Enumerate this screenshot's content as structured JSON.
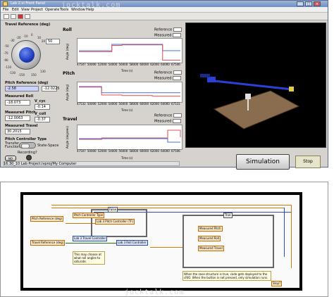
{
  "window": {
    "title": "Lab 2.vi Front Panel",
    "menu": [
      "File",
      "Edit",
      "View",
      "Project",
      "Operate",
      "Tools",
      "Window",
      "Help"
    ]
  },
  "watermark": "jocktalk.com",
  "controls": {
    "travel_reference": {
      "label": "Travel Reference (deg)",
      "value": "50",
      "scale": [
        "-10",
        "0",
        "10",
        "-20",
        "20",
        "-30",
        "30",
        "-40",
        "40",
        "-50",
        "50",
        "-60",
        "60",
        "-70",
        "70",
        "-80",
        "80",
        "-90",
        "90",
        "-100",
        "100",
        "-110",
        "110",
        "-120",
        "120",
        "-130",
        "130",
        "-140",
        "140",
        "-150",
        "150"
      ]
    },
    "pitch_reference": {
      "label": "Pitch Reference (deg)",
      "value": "-2.58",
      "value2": "-12.0225"
    },
    "measured_roll": {
      "label": "Measured Roll",
      "value": "-18.073"
    },
    "v_cyc": {
      "label": "V_cyc",
      "value": "-0.14"
    },
    "measured_pitch": {
      "label": "Measured Pitch",
      "value": "-12.0063"
    },
    "v_coll": {
      "label": "V_coll",
      "value": "-0.37"
    },
    "measured_travel": {
      "label": "Measured Travel",
      "value": "30.2015"
    },
    "pitch_controller_type": {
      "label": "Pitch Controller Type",
      "left": "Transfer Function",
      "right": "State-Space"
    },
    "recording": {
      "label": "Recording?"
    },
    "noimg": "NO"
  },
  "status": {
    "path": "16.30_10 Lab Project.lvproj/My Computer"
  },
  "charts": {
    "reference_label": "Reference",
    "measured_label": "Measured",
    "time_label": "Time (s)",
    "roll": {
      "title": "Roll",
      "ylabel": "Angle (deg)"
    },
    "pitch": {
      "title": "Pitch",
      "ylabel": "Angle (deg)"
    },
    "travel": {
      "title": "Travel",
      "ylabel": "Angle (degrees)"
    }
  },
  "buttons": {
    "simulation": "Simulation",
    "stop": "Stop"
  },
  "diagram": {
    "pitch_ref": "Pitch Reference (deg)",
    "pitch_ctrl_type": "Pitch Controller Type",
    "lab3_pitch": "Lab 3 Pitch Controller (TF)",
    "travel_ref": "Travel Reference (deg)",
    "lab3_travel": "Lab 3 Travel Controller",
    "lab3_roll": "Lab 3 Roll Controller",
    "note_left": "This may choose at what roll angles to saturate.",
    "note_right": "When the case structure is true, code gets deployed to the cRIO. When the button is not pressed, only simulation runs.",
    "case_false": "False",
    "case_true": "True",
    "stop_label": "Stop?",
    "out1": "Measured Pitch",
    "out2": "Measured Roll",
    "out3": "Measured Travel"
  },
  "chart_data": [
    {
      "type": "line",
      "title": "Roll",
      "ylabel": "Angle (deg)",
      "xlabel": "Time (s)",
      "x": [
        47507,
        50000,
        52000,
        54000,
        56000,
        58000,
        60000,
        62000,
        64000,
        65000,
        67506
      ],
      "xticks": [
        "47507",
        "50000",
        "52000",
        "54000",
        "56000",
        "58000",
        "60000",
        "62000",
        "64000",
        "67506"
      ],
      "series": [
        {
          "name": "Reference",
          "color": "#4a6fe0",
          "values": [
            0,
            0,
            0,
            12,
            12,
            12,
            12,
            12,
            0,
            0,
            0
          ]
        },
        {
          "name": "Measured",
          "color": "#e05050",
          "values": [
            -2,
            -2,
            -2,
            10,
            11,
            11,
            11,
            11,
            -18,
            -18,
            -18
          ]
        }
      ],
      "ylim": [
        -20,
        20
      ]
    },
    {
      "type": "line",
      "title": "Pitch",
      "ylabel": "Angle (deg)",
      "xlabel": "Time (s)",
      "x": [
        47532,
        50000,
        52000,
        54000,
        56000,
        58000,
        60000,
        62000,
        64000,
        65000,
        67531
      ],
      "xticks": [
        "47532",
        "50000",
        "52000",
        "54000",
        "56000",
        "58000",
        "60000",
        "62000",
        "64000",
        "67531"
      ],
      "series": [
        {
          "name": "Reference",
          "color": "#4a6fe0",
          "values": [
            5,
            5,
            -6,
            -6,
            -6,
            -6,
            -6,
            -6,
            -6,
            -6,
            -6
          ]
        },
        {
          "name": "Measured",
          "color": "#e05050",
          "values": [
            4,
            4,
            -10,
            -10,
            -11,
            -11,
            -11,
            -12,
            -12,
            -12,
            -12
          ]
        }
      ],
      "ylim": [
        -20,
        10
      ]
    },
    {
      "type": "line",
      "title": "Travel",
      "ylabel": "Angle (degrees)",
      "xlabel": "Time (s)",
      "x": [
        47507,
        50000,
        52000,
        54000,
        56000,
        58000,
        60000,
        62000,
        64000,
        65000,
        67506
      ],
      "xticks": [
        "47507",
        "50000",
        "52000",
        "54000",
        "56000",
        "58000",
        "60000",
        "62000",
        "64000",
        "67506"
      ],
      "series": [
        {
          "name": "Reference",
          "color": "#4a6fe0",
          "values": [
            80,
            80,
            80,
            80,
            80,
            80,
            80,
            80,
            80,
            30,
            30
          ]
        },
        {
          "name": "Measured",
          "color": "#e05050",
          "values": [
            70,
            70,
            90,
            90,
            90,
            90,
            90,
            90,
            90,
            200,
            100
          ]
        }
      ],
      "ylim": [
        -50,
        250
      ]
    }
  ]
}
